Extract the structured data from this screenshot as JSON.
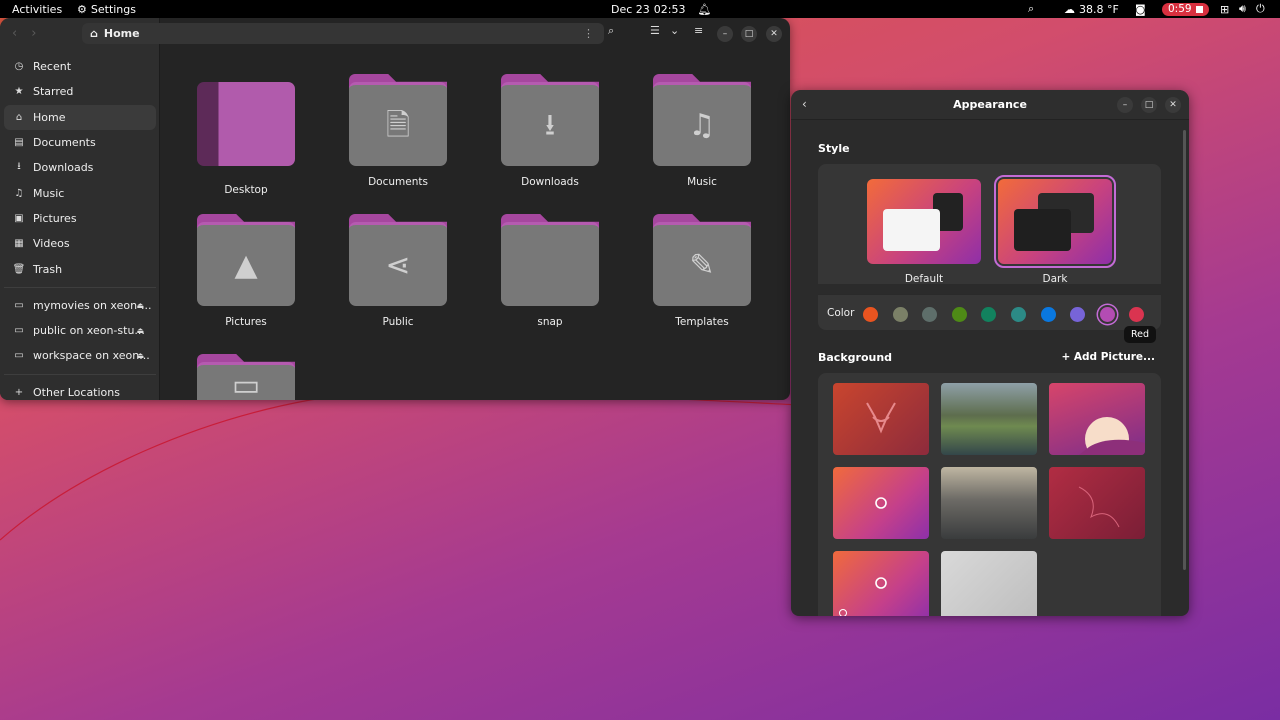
{
  "topbar": {
    "activities": "Activities",
    "app_name": "Settings",
    "date": "Dec 23",
    "time": "02:53",
    "weather": "38.8 °F",
    "recording_time": "0:59"
  },
  "files": {
    "path": "Home",
    "sidebar": {
      "places": [
        {
          "label": "Recent",
          "icon": "clock-icon"
        },
        {
          "label": "Starred",
          "icon": "star-icon"
        },
        {
          "label": "Home",
          "icon": "home-icon"
        },
        {
          "label": "Documents",
          "icon": "document-icon"
        },
        {
          "label": "Downloads",
          "icon": "download-icon"
        },
        {
          "label": "Music",
          "icon": "music-icon"
        },
        {
          "label": "Pictures",
          "icon": "picture-icon"
        },
        {
          "label": "Videos",
          "icon": "video-icon"
        },
        {
          "label": "Trash",
          "icon": "trash-icon"
        }
      ],
      "mounts": [
        {
          "label": "mymovies on xeon-..."
        },
        {
          "label": "public on xeon-stu..."
        },
        {
          "label": "workspace on xeon..."
        }
      ],
      "other": "Other Locations"
    },
    "folders": [
      {
        "label": "Desktop"
      },
      {
        "label": "Documents"
      },
      {
        "label": "Downloads"
      },
      {
        "label": "Music"
      },
      {
        "label": "Pictures"
      },
      {
        "label": "Public"
      },
      {
        "label": "snap"
      },
      {
        "label": "Templates"
      }
    ]
  },
  "appearance": {
    "title": "Appearance",
    "style_heading": "Style",
    "style_default": "Default",
    "style_dark": "Dark",
    "color_label": "Color",
    "colors": [
      "#e95420",
      "#7b8067",
      "#5e6e6a",
      "#4e8a16",
      "#12825e",
      "#2c8a86",
      "#0a78e0",
      "#7764d8",
      "#b34cb3",
      "#da3450"
    ],
    "selected_color_index": 8,
    "tooltip": "Red",
    "background_heading": "Background",
    "add_picture": "Add Picture..."
  }
}
